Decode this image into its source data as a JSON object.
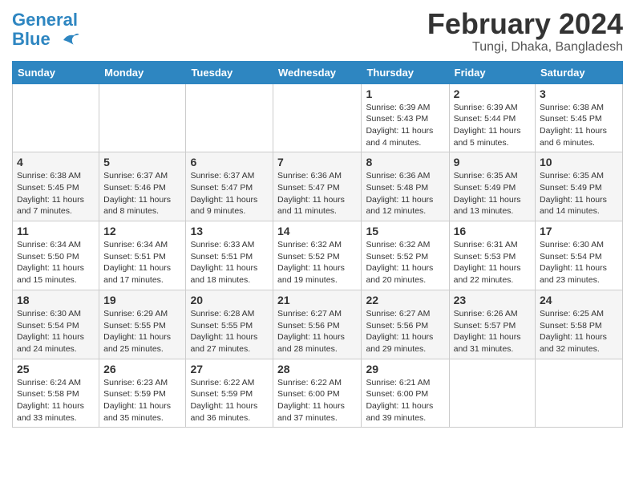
{
  "header": {
    "logo_general": "General",
    "logo_blue": "Blue",
    "month_year": "February 2024",
    "location": "Tungi, Dhaka, Bangladesh"
  },
  "weekdays": [
    "Sunday",
    "Monday",
    "Tuesday",
    "Wednesday",
    "Thursday",
    "Friday",
    "Saturday"
  ],
  "weeks": [
    [
      {
        "day": "",
        "sunrise": "",
        "sunset": "",
        "daylight": ""
      },
      {
        "day": "",
        "sunrise": "",
        "sunset": "",
        "daylight": ""
      },
      {
        "day": "",
        "sunrise": "",
        "sunset": "",
        "daylight": ""
      },
      {
        "day": "",
        "sunrise": "",
        "sunset": "",
        "daylight": ""
      },
      {
        "day": "1",
        "sunrise": "Sunrise: 6:39 AM",
        "sunset": "Sunset: 5:43 PM",
        "daylight": "Daylight: 11 hours and 4 minutes."
      },
      {
        "day": "2",
        "sunrise": "Sunrise: 6:39 AM",
        "sunset": "Sunset: 5:44 PM",
        "daylight": "Daylight: 11 hours and 5 minutes."
      },
      {
        "day": "3",
        "sunrise": "Sunrise: 6:38 AM",
        "sunset": "Sunset: 5:45 PM",
        "daylight": "Daylight: 11 hours and 6 minutes."
      }
    ],
    [
      {
        "day": "4",
        "sunrise": "Sunrise: 6:38 AM",
        "sunset": "Sunset: 5:45 PM",
        "daylight": "Daylight: 11 hours and 7 minutes."
      },
      {
        "day": "5",
        "sunrise": "Sunrise: 6:37 AM",
        "sunset": "Sunset: 5:46 PM",
        "daylight": "Daylight: 11 hours and 8 minutes."
      },
      {
        "day": "6",
        "sunrise": "Sunrise: 6:37 AM",
        "sunset": "Sunset: 5:47 PM",
        "daylight": "Daylight: 11 hours and 9 minutes."
      },
      {
        "day": "7",
        "sunrise": "Sunrise: 6:36 AM",
        "sunset": "Sunset: 5:47 PM",
        "daylight": "Daylight: 11 hours and 11 minutes."
      },
      {
        "day": "8",
        "sunrise": "Sunrise: 6:36 AM",
        "sunset": "Sunset: 5:48 PM",
        "daylight": "Daylight: 11 hours and 12 minutes."
      },
      {
        "day": "9",
        "sunrise": "Sunrise: 6:35 AM",
        "sunset": "Sunset: 5:49 PM",
        "daylight": "Daylight: 11 hours and 13 minutes."
      },
      {
        "day": "10",
        "sunrise": "Sunrise: 6:35 AM",
        "sunset": "Sunset: 5:49 PM",
        "daylight": "Daylight: 11 hours and 14 minutes."
      }
    ],
    [
      {
        "day": "11",
        "sunrise": "Sunrise: 6:34 AM",
        "sunset": "Sunset: 5:50 PM",
        "daylight": "Daylight: 11 hours and 15 minutes."
      },
      {
        "day": "12",
        "sunrise": "Sunrise: 6:34 AM",
        "sunset": "Sunset: 5:51 PM",
        "daylight": "Daylight: 11 hours and 17 minutes."
      },
      {
        "day": "13",
        "sunrise": "Sunrise: 6:33 AM",
        "sunset": "Sunset: 5:51 PM",
        "daylight": "Daylight: 11 hours and 18 minutes."
      },
      {
        "day": "14",
        "sunrise": "Sunrise: 6:32 AM",
        "sunset": "Sunset: 5:52 PM",
        "daylight": "Daylight: 11 hours and 19 minutes."
      },
      {
        "day": "15",
        "sunrise": "Sunrise: 6:32 AM",
        "sunset": "Sunset: 5:52 PM",
        "daylight": "Daylight: 11 hours and 20 minutes."
      },
      {
        "day": "16",
        "sunrise": "Sunrise: 6:31 AM",
        "sunset": "Sunset: 5:53 PM",
        "daylight": "Daylight: 11 hours and 22 minutes."
      },
      {
        "day": "17",
        "sunrise": "Sunrise: 6:30 AM",
        "sunset": "Sunset: 5:54 PM",
        "daylight": "Daylight: 11 hours and 23 minutes."
      }
    ],
    [
      {
        "day": "18",
        "sunrise": "Sunrise: 6:30 AM",
        "sunset": "Sunset: 5:54 PM",
        "daylight": "Daylight: 11 hours and 24 minutes."
      },
      {
        "day": "19",
        "sunrise": "Sunrise: 6:29 AM",
        "sunset": "Sunset: 5:55 PM",
        "daylight": "Daylight: 11 hours and 25 minutes."
      },
      {
        "day": "20",
        "sunrise": "Sunrise: 6:28 AM",
        "sunset": "Sunset: 5:55 PM",
        "daylight": "Daylight: 11 hours and 27 minutes."
      },
      {
        "day": "21",
        "sunrise": "Sunrise: 6:27 AM",
        "sunset": "Sunset: 5:56 PM",
        "daylight": "Daylight: 11 hours and 28 minutes."
      },
      {
        "day": "22",
        "sunrise": "Sunrise: 6:27 AM",
        "sunset": "Sunset: 5:56 PM",
        "daylight": "Daylight: 11 hours and 29 minutes."
      },
      {
        "day": "23",
        "sunrise": "Sunrise: 6:26 AM",
        "sunset": "Sunset: 5:57 PM",
        "daylight": "Daylight: 11 hours and 31 minutes."
      },
      {
        "day": "24",
        "sunrise": "Sunrise: 6:25 AM",
        "sunset": "Sunset: 5:58 PM",
        "daylight": "Daylight: 11 hours and 32 minutes."
      }
    ],
    [
      {
        "day": "25",
        "sunrise": "Sunrise: 6:24 AM",
        "sunset": "Sunset: 5:58 PM",
        "daylight": "Daylight: 11 hours and 33 minutes."
      },
      {
        "day": "26",
        "sunrise": "Sunrise: 6:23 AM",
        "sunset": "Sunset: 5:59 PM",
        "daylight": "Daylight: 11 hours and 35 minutes."
      },
      {
        "day": "27",
        "sunrise": "Sunrise: 6:22 AM",
        "sunset": "Sunset: 5:59 PM",
        "daylight": "Daylight: 11 hours and 36 minutes."
      },
      {
        "day": "28",
        "sunrise": "Sunrise: 6:22 AM",
        "sunset": "Sunset: 6:00 PM",
        "daylight": "Daylight: 11 hours and 37 minutes."
      },
      {
        "day": "29",
        "sunrise": "Sunrise: 6:21 AM",
        "sunset": "Sunset: 6:00 PM",
        "daylight": "Daylight: 11 hours and 39 minutes."
      },
      {
        "day": "",
        "sunrise": "",
        "sunset": "",
        "daylight": ""
      },
      {
        "day": "",
        "sunrise": "",
        "sunset": "",
        "daylight": ""
      }
    ]
  ]
}
